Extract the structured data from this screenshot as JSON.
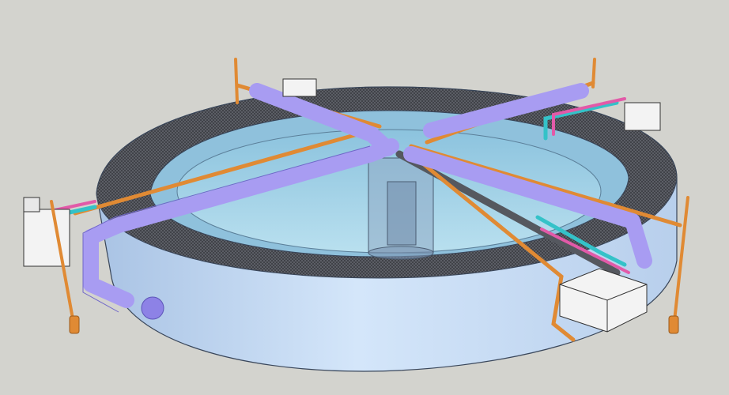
{
  "scene": {
    "description_free": true,
    "colors": {
      "background": "#d3d3ce",
      "tank_wall": "#c6dcf6",
      "tank_wall_shadow": "#9fb8d8",
      "tank_edge": "#39465a",
      "mesh_band": "#46484e",
      "water": "#9fd0e6",
      "water_deep": "#7fb9d6",
      "air_pipe": "#a89cf2",
      "air_pipe_dark": "#7f74d6",
      "orange_pipe": "#e08a34",
      "cyan_pipe": "#34c2c8",
      "pink_pipe": "#e25aa8",
      "grey_pipe": "#5a5d64",
      "box": "#f3f3f3",
      "center_column": "#8fa9c4"
    },
    "components": [
      "tank",
      "mesh-screen-band",
      "water-surface",
      "center-column",
      "air-manifold-arms",
      "orange-support-rods",
      "inlet-boxes",
      "vertical-posts"
    ]
  }
}
